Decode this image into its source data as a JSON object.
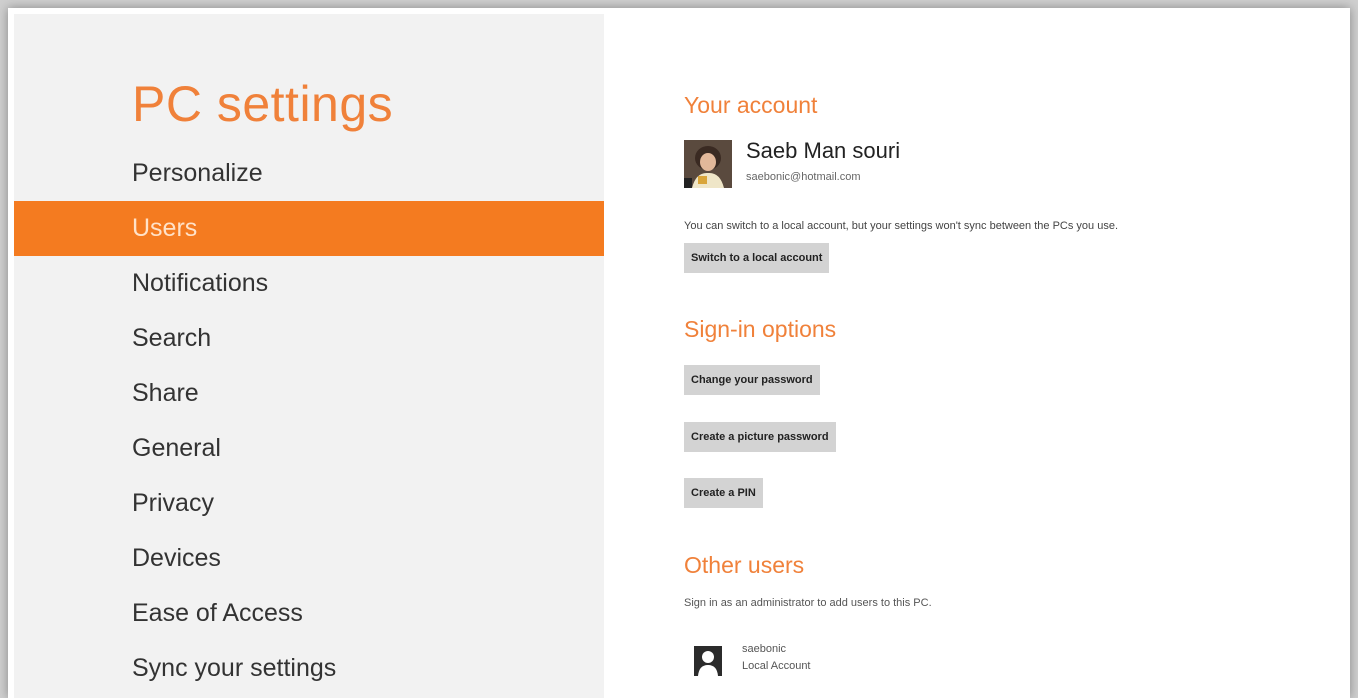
{
  "app": {
    "title": "PC settings"
  },
  "sidebar": {
    "items": [
      {
        "label": "Personalize",
        "selected": false
      },
      {
        "label": "Users",
        "selected": true
      },
      {
        "label": "Notifications",
        "selected": false
      },
      {
        "label": "Search",
        "selected": false
      },
      {
        "label": "Share",
        "selected": false
      },
      {
        "label": "General",
        "selected": false
      },
      {
        "label": "Privacy",
        "selected": false
      },
      {
        "label": "Devices",
        "selected": false
      },
      {
        "label": "Ease of Access",
        "selected": false
      },
      {
        "label": "Sync your settings",
        "selected": false
      }
    ]
  },
  "account": {
    "heading": "Your account",
    "name": "Saeb Man souri",
    "email": "saebonic@hotmail.com",
    "sync_note": "You can switch to a local account, but your settings won't sync between the PCs you use.",
    "switch_button": "Switch to a local account"
  },
  "signin": {
    "heading": "Sign-in options",
    "change_password_button": "Change your password",
    "picture_password_button": "Create a picture password",
    "pin_button": "Create a PIN"
  },
  "other_users": {
    "heading": "Other users",
    "note": "Sign in as an administrator to add users to this PC.",
    "users": [
      {
        "name": "saebonic",
        "type": "Local Account",
        "icon": "user-silhouette-icon"
      }
    ]
  },
  "colors": {
    "accent": "#f47b20",
    "heading": "#f0813a",
    "sidebar_bg": "#f2f2f2",
    "button_bg": "#d3d3d3"
  }
}
